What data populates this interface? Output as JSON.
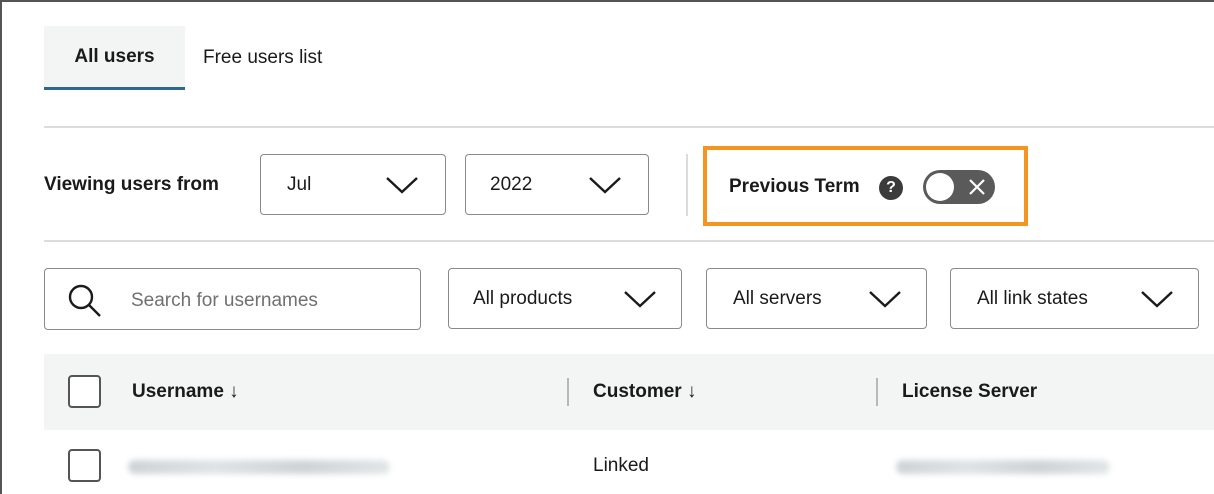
{
  "tabs": [
    {
      "label": "All users",
      "active": true
    },
    {
      "label": "Free users list",
      "active": false
    }
  ],
  "filters": {
    "viewing_label": "Viewing users from",
    "month": "Jul",
    "year": "2022",
    "previous_term_label": "Previous Term",
    "help_glyph": "?",
    "previous_term_enabled": false
  },
  "search": {
    "placeholder": "Search for usernames"
  },
  "dropdowns": {
    "products": "All products",
    "servers": "All servers",
    "link_states": "All link states"
  },
  "table": {
    "columns": [
      "Username ↓",
      "Customer ↓",
      "License Server"
    ],
    "rows": [
      {
        "username": "",
        "customer": "Linked",
        "license_server": ""
      }
    ]
  },
  "colors": {
    "accent_underline": "#2b6a8c",
    "highlight_border": "#f5951f",
    "toggle_off": "#5a5a5a"
  },
  "icons": [
    "search-icon",
    "chevron-down-icon",
    "help-icon",
    "close-icon"
  ]
}
